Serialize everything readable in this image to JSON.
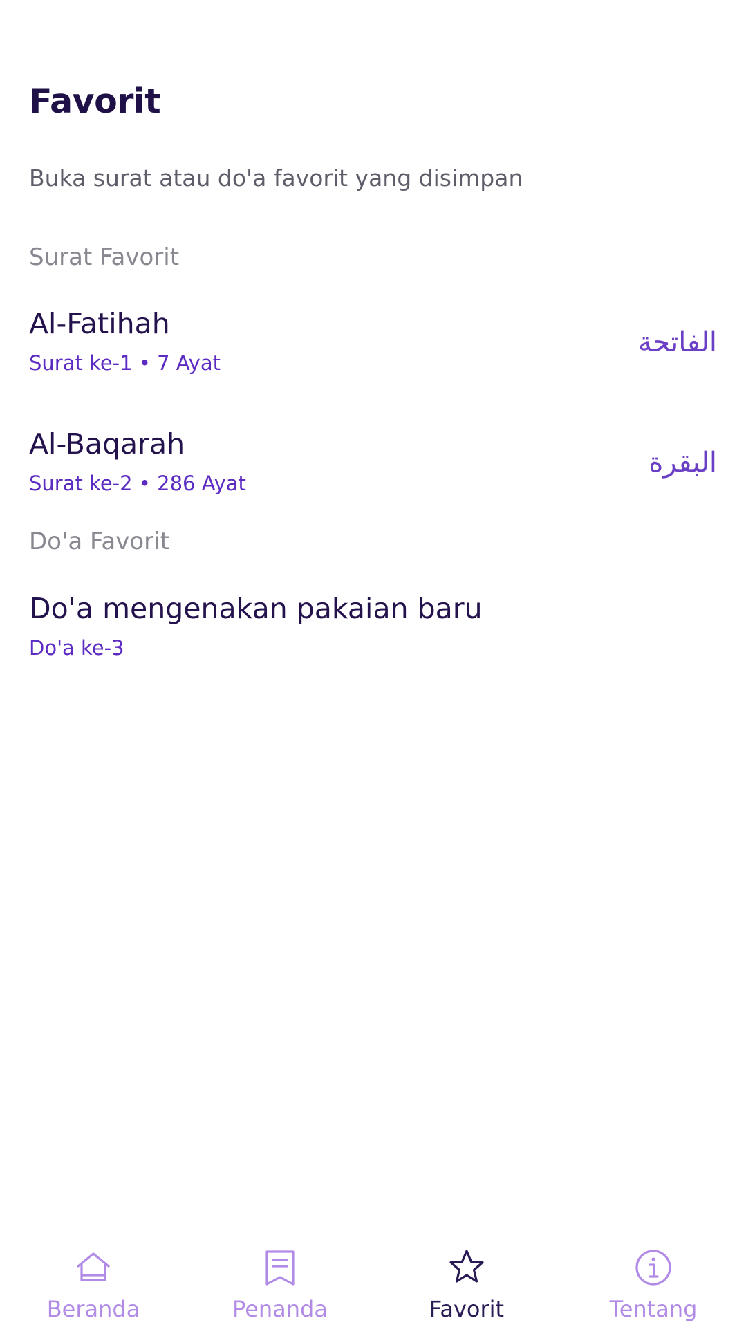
{
  "page": {
    "title": "Favorit",
    "subtitle": "Buka surat atau do'a favorit yang disimpan"
  },
  "sections": {
    "surat_label": "Surat Favorit",
    "doa_label": "Do'a Favorit"
  },
  "surat_items": [
    {
      "title": "Al-Fatihah",
      "subtitle": "Surat ke-1 • 7 Ayat",
      "arabic": "الفاتحة"
    },
    {
      "title": "Al-Baqarah",
      "subtitle": "Surat ke-2 • 286 Ayat",
      "arabic": "البقرة"
    }
  ],
  "doa_items": [
    {
      "title": "Do'a mengenakan pakaian baru",
      "subtitle": "Do'a ke-3"
    }
  ],
  "bottom_nav": {
    "items": [
      {
        "label": "Beranda",
        "icon": "home-icon",
        "active": false
      },
      {
        "label": "Penanda",
        "icon": "bookmark-icon",
        "active": false
      },
      {
        "label": "Favorit",
        "icon": "star-icon",
        "active": true
      },
      {
        "label": "Tentang",
        "icon": "info-icon",
        "active": false
      }
    ]
  },
  "colors": {
    "title": "#1f1147",
    "accent": "#5c2bc2",
    "nav_inactive": "#b18be6",
    "nav_active": "#2a1b55",
    "divider": "#bdb3ee"
  }
}
